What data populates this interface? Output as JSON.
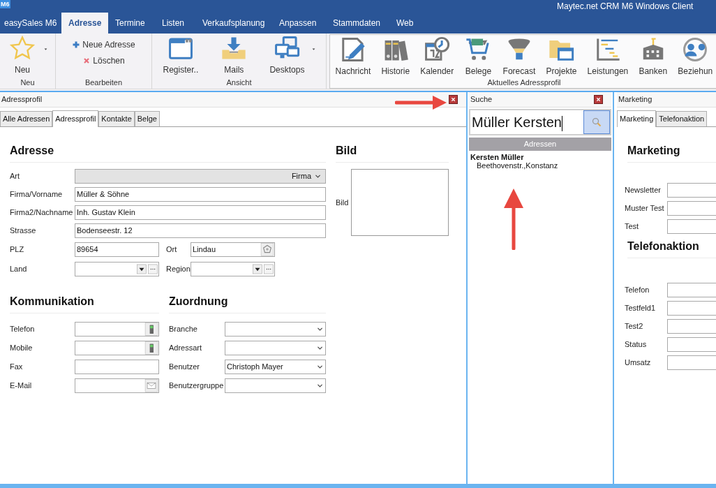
{
  "window": {
    "logo": "M6",
    "title": "Maytec.net CRM M6 Windows Client"
  },
  "ribbon_tabs": [
    {
      "label": "easySales M6",
      "selected": false
    },
    {
      "label": "Adresse",
      "selected": true
    },
    {
      "label": "Termine",
      "selected": false
    },
    {
      "label": "Listen",
      "selected": false
    },
    {
      "label": "Verkaufsplanung",
      "selected": false
    },
    {
      "label": "Anpassen",
      "selected": false
    },
    {
      "label": "Stammdaten",
      "selected": false
    },
    {
      "label": "Web",
      "selected": false
    }
  ],
  "ribbon_groups": [
    {
      "title": "Neu",
      "items": [
        {
          "label": "Neu",
          "kind": "large",
          "dropdown": true
        }
      ]
    },
    {
      "title": "Bearbeiten",
      "items": [
        {
          "label": "Neue Adresse",
          "kind": "small"
        },
        {
          "label": "Löschen",
          "kind": "small"
        }
      ]
    },
    {
      "title": "Ansicht",
      "items": [
        {
          "label": "Register..",
          "kind": "large",
          "dropdown": false
        },
        {
          "label": "Mails",
          "kind": "large",
          "dropdown": false
        },
        {
          "label": "Desktops",
          "kind": "large",
          "dropdown": true
        }
      ]
    },
    {
      "title": "Aktuelles Adressprofil",
      "items": [
        {
          "label": "Nachricht",
          "kind": "large",
          "dropdown": false
        },
        {
          "label": "Historie",
          "kind": "large",
          "dropdown": false
        },
        {
          "label": "Kalender",
          "kind": "large",
          "dropdown": false
        },
        {
          "label": "Belege",
          "kind": "large",
          "dropdown": false
        },
        {
          "label": "Forecast",
          "kind": "large",
          "dropdown": false
        },
        {
          "label": "Projekte",
          "kind": "large",
          "dropdown": false
        },
        {
          "label": "Leistungen",
          "kind": "large",
          "dropdown": false
        },
        {
          "label": "Banken",
          "kind": "large",
          "dropdown": false
        },
        {
          "label": "Beziehun",
          "kind": "large",
          "dropdown": false
        }
      ]
    }
  ],
  "address_panel": {
    "title": "Adressprofil",
    "tabs": [
      {
        "label": "Alle Adressen",
        "selected": false
      },
      {
        "label": "Adressprofil",
        "selected": true
      },
      {
        "label": "Kontakte",
        "selected": false
      },
      {
        "label": "Belge",
        "selected": false
      }
    ],
    "adresse": {
      "heading": "Adresse",
      "fields": [
        {
          "label": "Art",
          "kind": "fixed",
          "value": "Firma"
        },
        {
          "label": "Firma/Vorname",
          "kind": "text",
          "value": "Müller & Söhne"
        },
        {
          "label": "Firma2/Nachname",
          "kind": "text",
          "value": "Inh. Gustav Klein"
        },
        {
          "label": "Strasse",
          "kind": "text",
          "value": "Bodenseestr. 12"
        }
      ],
      "plz": {
        "label": "PLZ",
        "value": "89654"
      },
      "ort": {
        "label": "Ort",
        "value": "Lindau"
      },
      "land": {
        "label": "Land"
      },
      "region": {
        "label": "Region"
      }
    },
    "bild": {
      "heading": "Bild",
      "label": "Bild"
    },
    "kommunikation": {
      "heading": "Kommunikation",
      "fields": [
        {
          "label": "Telefon",
          "kind": "phone"
        },
        {
          "label": "Mobile",
          "kind": "phone"
        },
        {
          "label": "Fax",
          "kind": "text"
        },
        {
          "label": "E-Mail",
          "kind": "mail"
        }
      ]
    },
    "zuordnung": {
      "heading": "Zuordnung",
      "fields": [
        {
          "label": "Branche",
          "kind": "select"
        },
        {
          "label": "Adressart",
          "kind": "select"
        },
        {
          "label": "Benutzer",
          "kind": "select",
          "value": "Christoph Mayer"
        },
        {
          "label": "Benutzergruppe",
          "kind": "select"
        }
      ]
    }
  },
  "search_panel": {
    "title": "Suche",
    "query": "Müller Kersten",
    "results_header": "Adressen",
    "results": [
      {
        "name": "Kersten Müller",
        "address": "Beethovenstr.,Konstanz"
      }
    ]
  },
  "marketing_panel": {
    "title": "Marketing",
    "tabs": [
      {
        "label": "Marketing",
        "selected": true
      },
      {
        "label": "Telefonaktion",
        "selected": false
      }
    ],
    "sections": [
      {
        "heading": "Marketing",
        "fields": [
          "Newsletter",
          "Muster Test",
          "Test"
        ]
      },
      {
        "heading": "Telefonaktion",
        "fields": [
          "Telefon",
          "Testfeld1",
          "Test2",
          "Status",
          "Umsatz"
        ]
      }
    ]
  }
}
